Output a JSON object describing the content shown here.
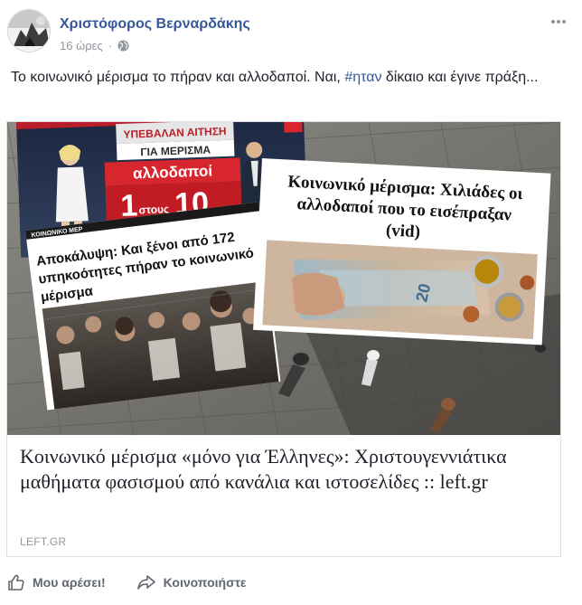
{
  "post": {
    "author": "Χριστόφορος Βερναρδάκης",
    "time": "16 ώρες",
    "separator": "·",
    "text_before": "Το κοινωνικό μέρισμα το πήραν και αλλοδαποί. Ναι, ",
    "hashtag": "#ηταν",
    "text_after": " δίκαιο και έγινε πράξη..."
  },
  "card": {
    "image_texts": {
      "tv_banner_1": "ΥΠΕΒΑΛΑΝ ΑΙΤΗΣΗ",
      "tv_banner_2": "ΓΙΑ ΜΕΡΙΣΜΑ",
      "tv_red_label": "αλλοδαποί",
      "tv_big_1": "1",
      "tv_stous": "στους",
      "tv_big_10": "10",
      "left_ticker": "ΚΟΙΝΩΝΙΚΟ ΜΕΡ",
      "left_headline_1": "Αποκάλυψη: Και ξένοι από 172",
      "left_headline_2": "υπηκοότητες πήραν το κοινωνικό",
      "left_headline_3": "μέρισμα",
      "right_headline_1": "Κοινωνικό μέρισμα: Χιλιάδες οι",
      "right_headline_2": "αλλοδαποί που το εισέπραξαν",
      "right_headline_3": "(vid)"
    },
    "title": "Κοινωνικό μέρισμα «μόνο για Έλληνες»: Χριστουγεννιάτικα μαθήματα φασισμού από κανάλια και ιστοσελίδες :: left.gr",
    "source": "LEFT.GR"
  },
  "actions": {
    "like": "Μου αρέσει!",
    "share": "Κοινοποιήστε"
  },
  "colors": {
    "link": "#365899",
    "meta": "#90949c",
    "action": "#606770",
    "tv_red": "#d7262e"
  },
  "icons": [
    "avatar-image",
    "globe-icon",
    "more-options-icon",
    "thumbs-up-icon",
    "share-arrow-icon"
  ]
}
